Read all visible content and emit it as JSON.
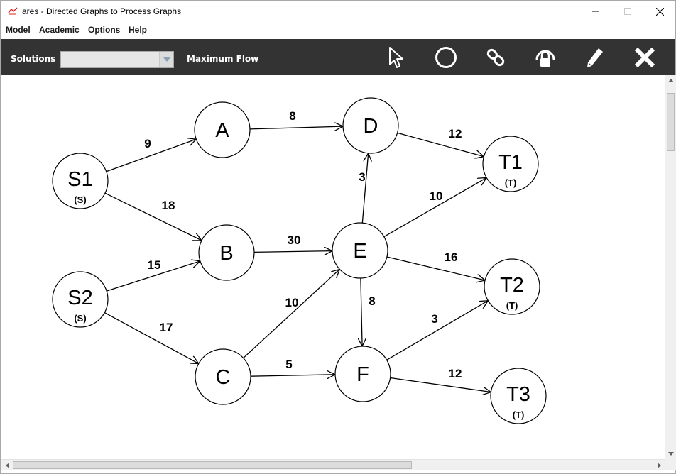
{
  "window": {
    "title": "ares - Directed Graphs to Process Graphs"
  },
  "menu": {
    "items": [
      "Model",
      "Academic",
      "Options",
      "Help"
    ]
  },
  "toolbar": {
    "solutions_label": "Solutions",
    "solutions_value": "",
    "mode_label": "Maximum Flow",
    "tools": [
      "pointer-tool",
      "node-tool",
      "link-tool",
      "lock-tool",
      "edit-tool",
      "delete-tool"
    ]
  },
  "graph": {
    "nodes": [
      {
        "id": "S1",
        "label": "S1",
        "tag": "(S)"
      },
      {
        "id": "S2",
        "label": "S2",
        "tag": "(S)"
      },
      {
        "id": "A",
        "label": "A",
        "tag": ""
      },
      {
        "id": "B",
        "label": "B",
        "tag": ""
      },
      {
        "id": "C",
        "label": "C",
        "tag": ""
      },
      {
        "id": "D",
        "label": "D",
        "tag": ""
      },
      {
        "id": "E",
        "label": "E",
        "tag": ""
      },
      {
        "id": "F",
        "label": "F",
        "tag": ""
      },
      {
        "id": "T1",
        "label": "T1",
        "tag": "(T)"
      },
      {
        "id": "T2",
        "label": "T2",
        "tag": "(T)"
      },
      {
        "id": "T3",
        "label": "T3",
        "tag": "(T)"
      }
    ],
    "edges": [
      {
        "from": "S1",
        "to": "A",
        "capacity": "9"
      },
      {
        "from": "S1",
        "to": "B",
        "capacity": "18"
      },
      {
        "from": "S2",
        "to": "B",
        "capacity": "15"
      },
      {
        "from": "S2",
        "to": "C",
        "capacity": "17"
      },
      {
        "from": "A",
        "to": "D",
        "capacity": "8"
      },
      {
        "from": "B",
        "to": "E",
        "capacity": "30"
      },
      {
        "from": "C",
        "to": "E",
        "capacity": "10"
      },
      {
        "from": "C",
        "to": "F",
        "capacity": "5"
      },
      {
        "from": "E",
        "to": "D",
        "capacity": "3"
      },
      {
        "from": "E",
        "to": "F",
        "capacity": "8"
      },
      {
        "from": "D",
        "to": "T1",
        "capacity": "12"
      },
      {
        "from": "E",
        "to": "T1",
        "capacity": "10"
      },
      {
        "from": "E",
        "to": "T2",
        "capacity": "16"
      },
      {
        "from": "F",
        "to": "T2",
        "capacity": "3"
      },
      {
        "from": "F",
        "to": "T3",
        "capacity": "12"
      }
    ]
  },
  "colors": {
    "toolbar_bg": "#333333",
    "node_stroke": "#000000",
    "edge": "#000000"
  }
}
